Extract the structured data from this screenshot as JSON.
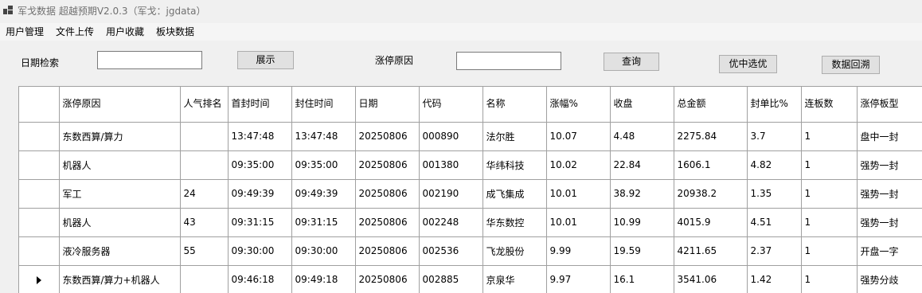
{
  "window": {
    "title": "军戈数据 超越预期V2.0.3（军戈：jgdata）"
  },
  "menu": [
    "用户管理",
    "文件上传",
    "用户收藏",
    "板块数据"
  ],
  "search": {
    "date_label": "日期检索",
    "date_value": "",
    "show_button": "展示",
    "reason_label": "涨停原因",
    "reason_value": "",
    "query_button": "查询",
    "pick_button": "优中选优",
    "backtest_button": "数据回溯"
  },
  "table": {
    "columns": [
      "涨停原因",
      "人气排名",
      "首封时间",
      "封住时间",
      "日期",
      "代码",
      "名称",
      "涨幅%",
      "收盘",
      "总金额",
      "封单比%",
      "连板数",
      "涨停板型"
    ],
    "rows": [
      [
        "东数西算/算力",
        "",
        "13:47:48",
        "13:47:48",
        "20250806",
        "000890",
        "法尔胜",
        "10.07",
        "4.48",
        "2275.84",
        "3.7",
        "1",
        "盘中一封"
      ],
      [
        "机器人",
        "",
        "09:35:00",
        "09:35:00",
        "20250806",
        "001380",
        "华纬科技",
        "10.02",
        "22.84",
        "1606.1",
        "4.82",
        "1",
        "强势一封"
      ],
      [
        "军工",
        "24",
        "09:49:39",
        "09:49:39",
        "20250806",
        "002190",
        "成飞集成",
        "10.01",
        "38.92",
        "20938.2",
        "1.35",
        "1",
        "强势一封"
      ],
      [
        "机器人",
        "43",
        "09:31:15",
        "09:31:15",
        "20250806",
        "002248",
        "华东数控",
        "10.01",
        "10.99",
        "4015.9",
        "4.51",
        "1",
        "强势一封"
      ],
      [
        "液冷服务器",
        "55",
        "09:30:00",
        "09:30:00",
        "20250806",
        "002536",
        "飞龙股份",
        "9.99",
        "19.59",
        "4211.65",
        "2.37",
        "1",
        "开盘一字"
      ],
      [
        "东数西算/算力+机器人",
        "",
        "09:46:18",
        "09:49:18",
        "20250806",
        "002885",
        "京泉华",
        "9.97",
        "16.1",
        "3541.06",
        "1.42",
        "1",
        "强势分歧"
      ]
    ],
    "current_row": 5
  }
}
